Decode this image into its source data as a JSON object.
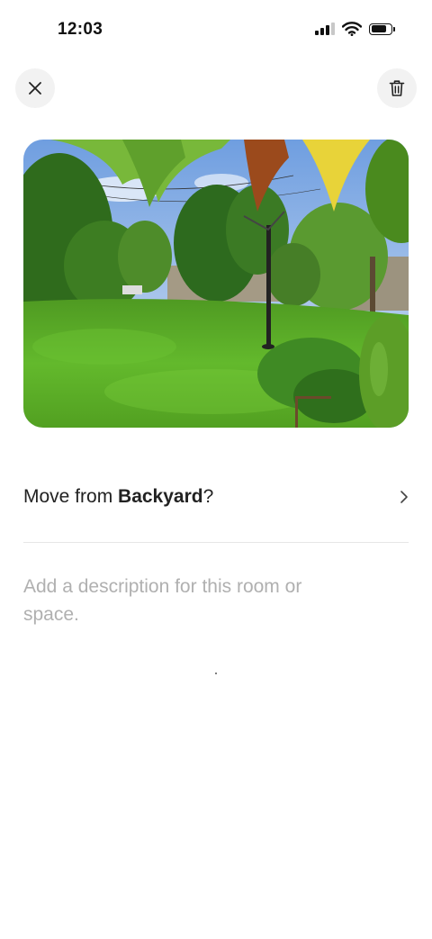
{
  "status_bar": {
    "time": "12:03",
    "icons": [
      "cellular-signal-icon",
      "wifi-icon",
      "battery-icon"
    ]
  },
  "header": {
    "close_icon": "close-icon",
    "delete_icon": "trash-icon"
  },
  "photo": {
    "subject": "backyard-lawn-photo"
  },
  "move_row": {
    "prefix": "Move from ",
    "room": "Backyard",
    "suffix": "?",
    "chevron_icon": "chevron-right-icon"
  },
  "description": {
    "placeholder": "Add a description for this room or space."
  },
  "colors": {
    "text": "#222222",
    "placeholder": "#b0b0b0",
    "button_bg": "#f2f2f2",
    "divider": "#e6e6e6"
  }
}
